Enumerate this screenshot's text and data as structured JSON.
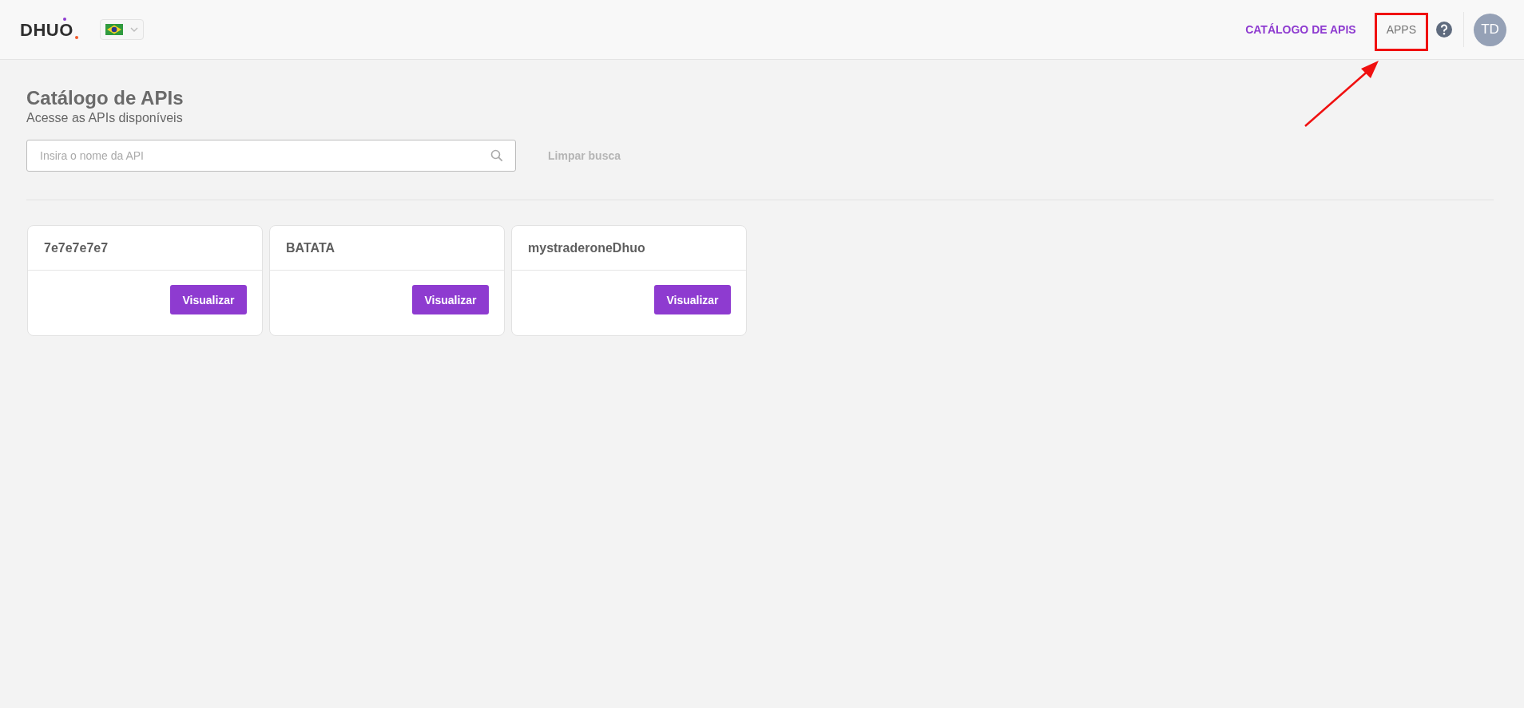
{
  "header": {
    "logo": "DHUO",
    "nav": [
      {
        "label": "CATÁLOGO DE APIS",
        "selected": true,
        "highlighted": false
      },
      {
        "label": "APPS",
        "selected": false,
        "highlighted": true
      }
    ],
    "avatar": "TD"
  },
  "page": {
    "title": "Catálogo de APIs",
    "subtitle": "Acesse as APIs disponíveis",
    "search": {
      "placeholder": "Insira o nome da API"
    },
    "clear": "Limpar busca"
  },
  "cards": [
    {
      "title": "7e7e7e7e7",
      "button": "Visualizar"
    },
    {
      "title": "BATATA",
      "button": "Visualizar"
    },
    {
      "title": "mystraderoneDhuo",
      "button": "Visualizar"
    }
  ]
}
